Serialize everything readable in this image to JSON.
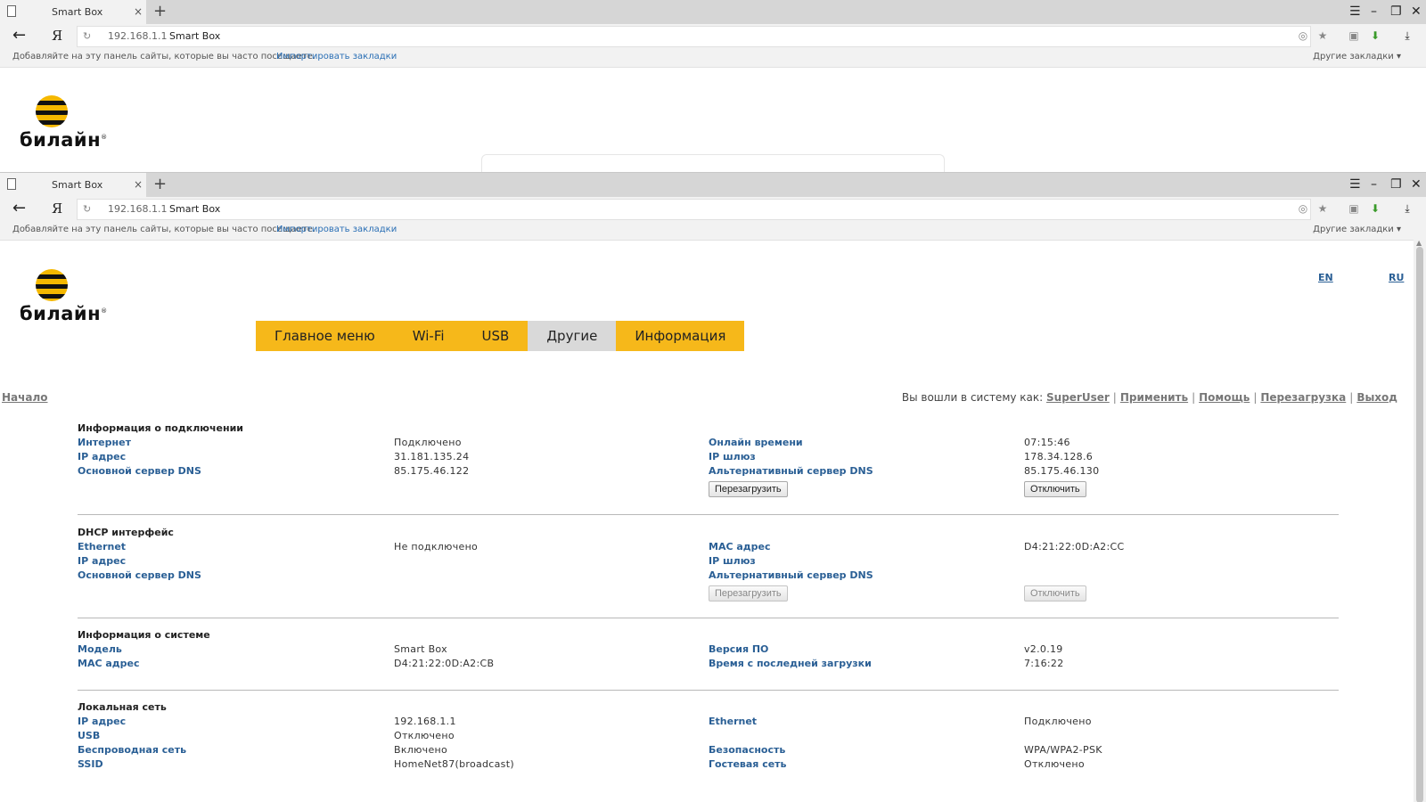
{
  "browser": {
    "tab_title": "Smart Box",
    "tab_close": "×",
    "new_tab": "+",
    "ip": "192.168.1.1",
    "site": "Smart Box",
    "ya": "Я",
    "bookmarks_hint": "Добавляйте на эту панель сайты, которые вы часто посещаете.",
    "import_bookmarks": "Импортировать закладки",
    "other_bookmarks": "Другие закладки ▾"
  },
  "logo": {
    "wordmark": "билайн",
    "reg": "®"
  },
  "lang": {
    "en": "EN",
    "ru": "RU"
  },
  "menu": [
    "Главное меню",
    "Wi-Fi",
    "USB",
    "Другие",
    "Информация"
  ],
  "menu_active_index": 3,
  "nav": {
    "start": "Начало",
    "logged_in": "Вы вошли в систему как:",
    "user": "SuperUser",
    "apply": "Применить",
    "help": "Помощь",
    "reboot": "Перезагрузка",
    "logout": "Выход"
  },
  "connection": {
    "title": "Информация о подключении",
    "rows": [
      [
        "Интернет",
        "Подключено",
        "Онлайн времени",
        "07:15:46"
      ],
      [
        "IP адрес",
        "31.181.135.24",
        "IP шлюз",
        "178.34.128.6"
      ],
      [
        "Основной сервер DNS",
        "85.175.46.122",
        "Альтернативный сервер DNS",
        "85.175.46.130"
      ]
    ],
    "reboot_btn": "Перезагрузить",
    "disconnect_btn": "Отключить"
  },
  "dhcp": {
    "title": "DHCP интерфейс",
    "rows": [
      [
        "Ethernet",
        "Не подключено",
        "MAC адрес",
        "D4:21:22:0D:A2:CC"
      ],
      [
        "IP адрес",
        "",
        "IP шлюз",
        ""
      ],
      [
        "Основной сервер DNS",
        "",
        "Альтернативный сервер DNS",
        ""
      ]
    ],
    "reboot_btn": "Перезагрузить",
    "disconnect_btn": "Отключить"
  },
  "system": {
    "title": "Информация о системе",
    "rows": [
      [
        "Модель",
        "Smart Box",
        "Версия ПО",
        "v2.0.19"
      ],
      [
        "MAC адрес",
        "D4:21:22:0D:A2:CB",
        "Время с последней загрузки",
        "7:16:22"
      ]
    ]
  },
  "lan": {
    "title": "Локальная сеть",
    "rows": [
      [
        "IP адрес",
        "192.168.1.1",
        "Ethernet",
        "Подключено"
      ],
      [
        "USB",
        "Отключено",
        "",
        ""
      ],
      [
        "Беспроводная сеть",
        "Включено",
        "Безопасность",
        "WPA/WPA2-PSK"
      ],
      [
        "SSID",
        "HomeNet87(broadcast)",
        "Гостевая сеть",
        "Отключено"
      ]
    ]
  },
  "colors": {
    "menu_yellow": "#f6b81a",
    "link_blue": "#2a5f95",
    "active_tab": "#d9d9d9"
  }
}
